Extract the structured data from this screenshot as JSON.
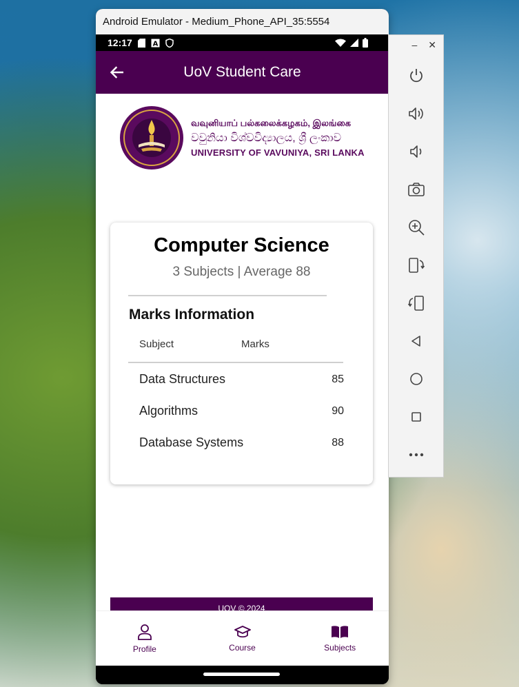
{
  "window": {
    "title": "Android Emulator - Medium_Phone_API_35:5554"
  },
  "status_bar": {
    "time": "12:17"
  },
  "app_bar": {
    "title": "UoV Student Care"
  },
  "logo": {
    "line1": "வவுனியாப் பல்கலைக்கழகம், இலங்கை",
    "line2": "වවුනියා විශ්වවිද්‍යාලය, ශ්‍රී ලංකාව",
    "line3": "UNIVERSITY OF VAVUNIYA, SRI LANKA"
  },
  "card": {
    "department": "Computer Science",
    "summary": "3 Subjects | Average  88",
    "section_title": "Marks Information",
    "columns": {
      "subject": "Subject",
      "marks": "Marks"
    },
    "rows": [
      {
        "subject": "Data Structures",
        "mark": "85"
      },
      {
        "subject": "Algorithms",
        "mark": "90"
      },
      {
        "subject": "Database Systems",
        "mark": "88"
      }
    ]
  },
  "footer": {
    "text": "UOV © 2024"
  },
  "bottom_nav": {
    "items": [
      {
        "label": "Profile",
        "icon": "person-icon"
      },
      {
        "label": "Course",
        "icon": "graduation-cap-icon"
      },
      {
        "label": "Subjects",
        "icon": "book-icon"
      }
    ]
  },
  "side_panel": {
    "window_controls": {
      "minimize": "–",
      "close": "✕"
    },
    "buttons": [
      {
        "icon": "power-icon"
      },
      {
        "icon": "volume-up-icon"
      },
      {
        "icon": "volume-down-icon"
      },
      {
        "icon": "camera-icon"
      },
      {
        "icon": "zoom-icon"
      },
      {
        "icon": "rotate-left-icon"
      },
      {
        "icon": "rotate-right-icon"
      },
      {
        "icon": "back-icon"
      },
      {
        "icon": "home-icon"
      },
      {
        "icon": "overview-icon"
      },
      {
        "icon": "more-icon"
      }
    ]
  },
  "colors": {
    "brand": "#4a0050"
  }
}
